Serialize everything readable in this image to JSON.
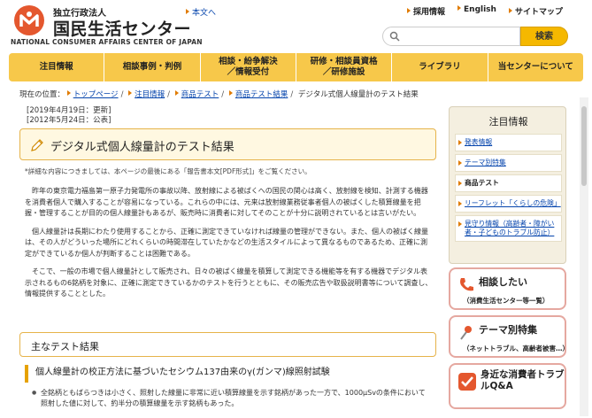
{
  "header": {
    "org_small": "独立行政法人",
    "org_big": "国民生活センター",
    "org_en": "NATIONAL CONSUMER AFFAIRS CENTER OF JAPAN",
    "skip_link": "本文へ",
    "top_links": [
      "採用情報",
      "English",
      "サイトマップ"
    ],
    "search_placeholder": "",
    "search_button": "検索"
  },
  "nav": [
    "注目情報",
    "相談事例・判例",
    "相談・紛争解決／情報受付",
    "研修・相談員資格／研修施設",
    "ライブラリ",
    "当センターについて"
  ],
  "breadcrumb": {
    "prefix": "現在の位置：",
    "items": [
      "トップページ",
      "注目情報",
      "商品テスト",
      "商品テスト結果"
    ],
    "current": "デジタル式個人線量計のテスト結果"
  },
  "dates": [
    "[2019年4月19日：更新]",
    "[2012年5月24日：公表]"
  ],
  "page_title": "デジタル式個人線量計のテスト結果",
  "note": "*詳細な内容につきましては、本ページの最後にある「報告書本文[PDF形式]」をご覧ください。",
  "paragraphs": [
    "昨年の東京電力福島第一原子力発電所の事故以降、放射線による被ばくへの国民の関心は高く、放射線を検知、計測する機器を消費者個人で購入することが容易になっている。これらの中には、元来は放射線業務従事者個人の被ばくした積算線量を把握・管理することが目的の個人線量計もあるが、販売時に消費者に対してそのことが十分に説明されているとは言いがたい。",
    "個人線量計は長期にわたり使用することから、正確に測定できていなければ線量の管理ができない。また、個人の被ばく線量は、その人がどういった場所にどれくらいの時間滞在していたかなどの生活スタイルによって異なるものであるため、正確に測定ができているか個人が判断することは困難である。",
    "そこで、一般の市場で個人線量計として販売され、日々の被ばく線量を積算して測定できる機能等を有する機器でデジタル表示されるもの6銘柄を対象に、正確に測定できているかのテストを行うとともに、その販売広告や取扱説明書等について調査し、情報提供することとした。"
  ],
  "section_heading": "主なテスト結果",
  "sub_heading": "個人線量計の校正方法に基づいたセシウム137由来のγ(ガンマ)線照射試験",
  "bullets": [
    "全銘柄ともばらつきは小さく、照射した線量に非常に近い積算線量を示す銘柄があった一方で、1000μSvの条件において照射した値に対して、約半分の積算線量を示す銘柄もあった。"
  ],
  "sidebar": {
    "title": "注目情報",
    "items": [
      "発表情報",
      "テーマ別特集",
      "商品テスト",
      "リーフレット「くらしの危険」",
      "見守り情報（高齢者・障がい者・子どものトラブル防止）"
    ]
  },
  "banners": [
    {
      "title": "相談したい",
      "sub": "（消費生活センター等一覧）"
    },
    {
      "title": "テーマ別特集",
      "sub": "（ネットトラブル、高齢者被害…）"
    },
    {
      "title": "身近な消費者トラブルQ&A",
      "sub": ""
    }
  ],
  "colors": {
    "accent": "#f7c84a",
    "brand": "#e4572e",
    "link": "#0645ad",
    "title_border": "#e6b34a"
  }
}
